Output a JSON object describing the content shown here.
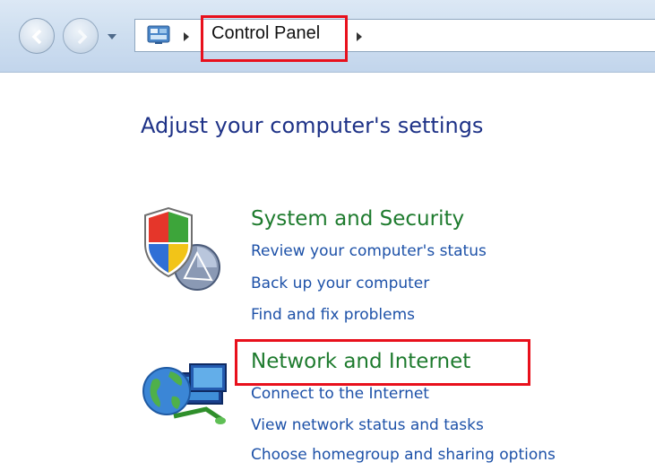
{
  "address_bar": {
    "breadcrumb": "Control Panel",
    "back_icon": "back-arrow-icon",
    "forward_icon": "forward-arrow-icon",
    "recent_pages_icon": "chevron-down-icon",
    "location_icon": "control-panel-icon"
  },
  "main": {
    "title": "Adjust your computer's settings",
    "categories": [
      {
        "title": "System and Security",
        "icon": "shield-icon",
        "tasks": [
          "Review your computer's status",
          "Back up your computer",
          "Find and fix problems"
        ]
      },
      {
        "title": "Network and Internet",
        "icon": "network-globe-icon",
        "tasks": [
          "Connect to the Internet",
          "View network status and tasks",
          "Choose homegroup and sharing options"
        ]
      }
    ]
  },
  "colors": {
    "title": "#1e3287",
    "category": "#1e7b2e",
    "link": "#1d51a8",
    "highlight": "#e8101c"
  }
}
